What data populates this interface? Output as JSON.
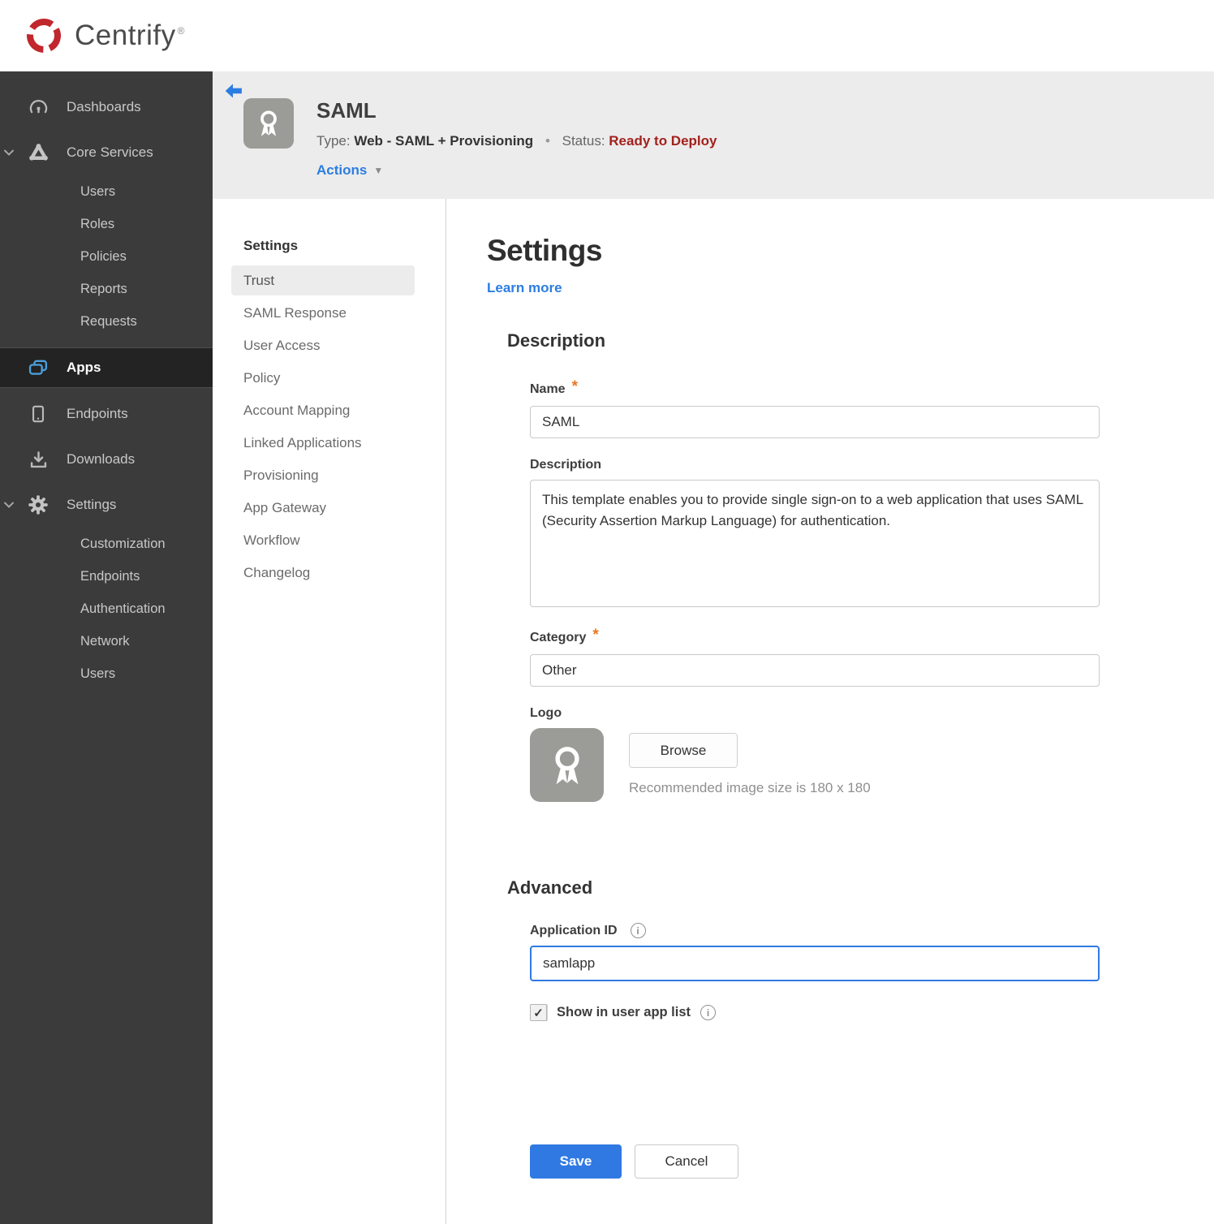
{
  "brand": {
    "name": "Centrify",
    "trademark": "®"
  },
  "colors": {
    "brand_red": "#c1272d",
    "accent_blue": "#2b7de1",
    "apps_icon_blue": "#4ba0dc",
    "status_red": "#a3211c",
    "required_orange": "#e87722",
    "sidebar_bg": "#3b3b3b",
    "sidebar_active_bg": "#232323",
    "header_bg": "#ececec"
  },
  "icons": {
    "check": "✓",
    "info": "i",
    "caret_down": "▼",
    "bullet": "•",
    "asterisk": "*"
  },
  "sidebar": {
    "items": [
      {
        "label": "Dashboards",
        "icon": "gauge-icon"
      },
      {
        "label": "Core Services",
        "icon": "core-services-icon",
        "expanded": true
      },
      {
        "label": "Users"
      },
      {
        "label": "Roles"
      },
      {
        "label": "Policies"
      },
      {
        "label": "Reports"
      },
      {
        "label": "Requests"
      },
      {
        "label": "Apps",
        "icon": "apps-icon",
        "active": true
      },
      {
        "label": "Endpoints",
        "icon": "endpoint-icon"
      },
      {
        "label": "Downloads",
        "icon": "download-icon"
      },
      {
        "label": "Settings",
        "icon": "gear-icon",
        "expanded": true
      },
      {
        "label": "Customization"
      },
      {
        "label": "Endpoints"
      },
      {
        "label": "Authentication"
      },
      {
        "label": "Network"
      },
      {
        "label": "Users"
      }
    ]
  },
  "app_header": {
    "title": "SAML",
    "type_label": "Type:",
    "type_value": "Web - SAML + Provisioning",
    "status_label": "Status:",
    "status_value": "Ready to Deploy",
    "actions_label": "Actions"
  },
  "subnav": {
    "header": "Settings",
    "active_item": "Trust",
    "items": [
      "Trust",
      "SAML Response",
      "User Access",
      "Policy",
      "Account Mapping",
      "Linked Applications",
      "Provisioning",
      "App Gateway",
      "Workflow",
      "Changelog"
    ]
  },
  "main": {
    "title": "Settings",
    "learn_more": "Learn more",
    "description": {
      "heading": "Description",
      "name_label": "Name",
      "name_value": "SAML",
      "description_label": "Description",
      "description_value": "This template enables you to provide single sign-on to a web application that uses SAML (Security Assertion Markup Language) for authentication.",
      "category_label": "Category",
      "category_value": "Other",
      "logo_label": "Logo",
      "browse_label": "Browse",
      "logo_hint": "Recommended image size is 180 x 180"
    },
    "advanced": {
      "heading": "Advanced",
      "app_id_label": "Application ID",
      "app_id_value": "samlapp",
      "show_in_app_list_label": "Show in user app list",
      "show_in_app_list_checked": true
    },
    "footer": {
      "save_label": "Save",
      "cancel_label": "Cancel"
    }
  }
}
